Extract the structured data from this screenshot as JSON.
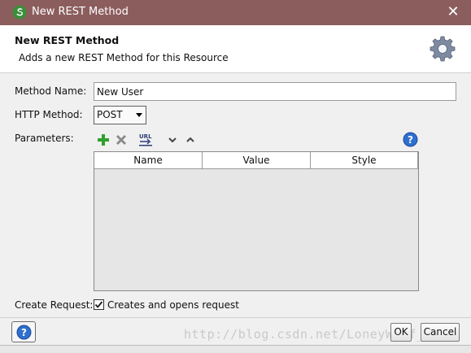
{
  "window": {
    "title": "New REST Method",
    "close_glyph": "✕"
  },
  "header": {
    "title": "New REST Method",
    "subtitle": "Adds a new REST Method for this Resource",
    "icon": "gear-icon"
  },
  "form": {
    "method_name_label": "Method Name:",
    "method_name_value": "New User",
    "http_method_label": "HTTP Method:",
    "http_method_value": "POST",
    "parameters_label": "Parameters:",
    "create_request_label": "Create Request:",
    "create_request_checked": true,
    "create_request_text": "Creates and opens request"
  },
  "toolbar": {
    "icons": [
      "add-icon",
      "remove-icon",
      "url-icon",
      "move-down-icon",
      "move-up-icon",
      "help-icon"
    ]
  },
  "table": {
    "columns": [
      "Name",
      "Value",
      "Style"
    ],
    "rows": []
  },
  "buttons": {
    "ok": "OK",
    "cancel": "Cancel"
  },
  "watermark": "http://blog.csdn.net/LoneyWolf_0326",
  "colors": {
    "titlebar": "#8c5d5d",
    "add": "#2fa12f",
    "remove": "#8a8a8a",
    "help": "#2f6fcf"
  }
}
